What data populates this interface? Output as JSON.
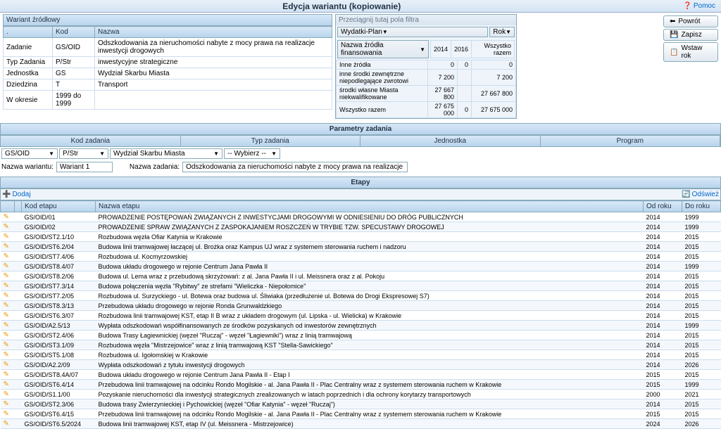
{
  "header": {
    "title": "Edycja wariantu (kopiowanie)",
    "help": "Pomoc",
    "back": "Powrót",
    "save": "Zapisz",
    "insert_year": "Wstaw rok"
  },
  "variant_panel": {
    "title": "Wariant źródłowy",
    "cols": {
      "dot": ".",
      "kod": "Kod",
      "nazwa": "Nazwa"
    },
    "rows": [
      {
        "label": "Zadanie",
        "kod": "GS/OID",
        "nazwa": "Odszkodowania za nieruchomości nabyte z mocy prawa na realizacje inwestycji drogowych"
      },
      {
        "label": "Typ Zadania",
        "kod": "P/Str",
        "nazwa": "inwestycyjne strategiczne"
      },
      {
        "label": "Jednostka",
        "kod": "GS",
        "nazwa": "Wydział Skarbu Miasta"
      },
      {
        "label": "Dziedzina",
        "kod": "T",
        "nazwa": "Transport"
      },
      {
        "label": "W okresie",
        "kod": "1999 do 1999",
        "nazwa": ""
      }
    ]
  },
  "filter": {
    "drag_hint": "Przeciągnij tutaj pola filtra",
    "wydatki": "Wydatki-Plan",
    "rok": "Rok",
    "source_label": "Nazwa źródła finansowania",
    "years": [
      "2014",
      "2016",
      "Wszystko razem"
    ],
    "rows": [
      {
        "name": "Inne źródła",
        "v": [
          "0",
          "0",
          "0"
        ]
      },
      {
        "name": "inne środki zewnętrzne niepodlegające zwrotowi",
        "v": [
          "7 200",
          "",
          "7 200"
        ]
      },
      {
        "name": "środki własne Miasta niekwalifikowane",
        "v": [
          "27 667 800",
          "",
          "27 667 800"
        ]
      },
      {
        "name": "Wszystko razem",
        "v": [
          "27 675 000",
          "0",
          "27 675 000"
        ]
      }
    ]
  },
  "params": {
    "title": "Parametry zadania",
    "headers": [
      "Kod zadania",
      "Typ zadania",
      "Jednostka",
      "Program"
    ],
    "values": [
      "GS/OID",
      "P/Str",
      "Wydział Skarbu Miasta",
      "-- Wybierz --"
    ],
    "variant_label": "Nazwa wariantu:",
    "variant_value": "Wariant 1",
    "task_label": "Nazwa zadania:",
    "task_value": "Odszkodowania za nieruchomości nabyte z mocy prawa na realizacje inwestycji drogowych"
  },
  "etapy": {
    "title": "Etapy",
    "add": "Dodaj",
    "refresh": "Odśwież",
    "cols": [
      "Kod etapu",
      "Nazwa etapu",
      "Od roku",
      "Do roku"
    ],
    "rows": [
      {
        "k": "GS/OID/01",
        "n": "PROWADZENIE POSTĘPOWAŃ ZWIĄZANYCH Z INWESTYCJAMI DROGOWYMI W ODNIESIENIU DO DRÓG PUBLICZNYCH",
        "od": "2014",
        "do": "1999"
      },
      {
        "k": "GS/OID/02",
        "n": "PROWADZENIE SPRAW ZWIĄZANYCH Z ZASPOKAJANIEM ROSZCZEŃ W TRYBIE TZW. SPECUSTAWY DROGOWEJ",
        "od": "2014",
        "do": "1999"
      },
      {
        "k": "GS/OID/ST2.1/10",
        "n": "Rozbudowa węzła Ofiar Katynia w Krakowie",
        "od": "2014",
        "do": "2015"
      },
      {
        "k": "GS/OID/ST6.2/04",
        "n": "Budowa linii tramwajowej łaczącej ul. Brożka oraz Kampus UJ wraz z systemem sterowania ruchem i nadzoru",
        "od": "2014",
        "do": "2015"
      },
      {
        "k": "GS/OID/ST7.4/06",
        "n": "Rozbudowa ul. Kocmyrzowskiej",
        "od": "2014",
        "do": "2015"
      },
      {
        "k": "GS/OID/ST8.4/07",
        "n": "Budowa układu drogowego w rejonie Centrum Jana Pawła II",
        "od": "2014",
        "do": "1999"
      },
      {
        "k": "GS/OID/ST8.2/06",
        "n": "Budowa ul. Lema wraz z przebudową skrzyżowań: z al. Jana Pawła II i ul. Meissnera oraz z al. Pokoju",
        "od": "2014",
        "do": "2015"
      },
      {
        "k": "GS/OID/ST7.3/14",
        "n": "Budowa połączenia węzła \"Rybitwy\" ze strefami \"Wieliczka - Niepołomice\"",
        "od": "2014",
        "do": "2015"
      },
      {
        "k": "GS/OID/ST7.2/05",
        "n": "Rozbudowa ul. Surzyckiego - ul. Botewa oraz budowa ul. Śliwiaka (przedłużenie ul. Botewa do Drogi Ekspresowej S7)",
        "od": "2014",
        "do": "2015"
      },
      {
        "k": "GS/OID/ST8.3/13",
        "n": "Przebudowa układu drogowego w rejonie Ronda Grunwaldzkiego",
        "od": "2014",
        "do": "2015"
      },
      {
        "k": "GS/OID/ST6.3/07",
        "n": "Rozbudowa linii tramwajowej KST, etap II B wraz z układem drogowym (ul. Lipska - ul. Wielicka) w Krakowie",
        "od": "2014",
        "do": "2015"
      },
      {
        "k": "GS/OID/A2.5/13",
        "n": "Wypłata odszkodowań współfinansowanych ze środków pozyskanych od inwestorów zewnętrznych",
        "od": "2014",
        "do": "1999"
      },
      {
        "k": "GS/OID/ST2.4/06",
        "n": "Budowa Trasy Łagiewnickiej (węzeł \"Ruczaj\" - węzeł \"Łagiewniki\") wraz z linią tramwajową",
        "od": "2014",
        "do": "2015"
      },
      {
        "k": "GS/OID/ST3.1/09",
        "n": "Rozbudowa węzła \"Mistrzejowice\" wraz z linią tramwajową KST \"Stella-Sawickiego\"",
        "od": "2014",
        "do": "2015"
      },
      {
        "k": "GS/OID/ST5.1/08",
        "n": "Rozbudowa ul. Igołomskiej w Krakowie",
        "od": "2014",
        "do": "2015"
      },
      {
        "k": "GS/OID/A2.2/09",
        "n": "Wypłata odszkodowań z tytułu inwestycji drogowych",
        "od": "2014",
        "do": "2026"
      },
      {
        "k": "GS/OID/ST8.4A/07",
        "n": "Budowa układu drogowego w rejonie Centrum Jana Pawła II - Etap I",
        "od": "2015",
        "do": "2015"
      },
      {
        "k": "GS/OID/ST6.4/14",
        "n": "Przebudowa linii tramwajowej na odcinku Rondo Mogilskie - al. Jana Pawła II - Plac Centralny wraz z systemem sterowania ruchem w Krakowie",
        "od": "2015",
        "do": "1999"
      },
      {
        "k": "GS/OID/S1.1/00",
        "n": "Pozyskanie nieruchomości dla inwestycji strategicznych zrealizowanych w latach poprzednich i dla ochrony korytarzy transportowych",
        "od": "2000",
        "do": "2021"
      },
      {
        "k": "GS/OID/ST2.3/06",
        "n": "Budowa trasy Zwierzynieckiej i Pychowickiej (węzeł \"Ofiar Katynia\" - węzeł \"Ruczaj\")",
        "od": "2014",
        "do": "2015"
      },
      {
        "k": "GS/OID/ST6.4/15",
        "n": "Przebudowa linii tramwajowej na odcinku Rondo Mogilskie - al. Jana Pawła II - Plac Centralny wraz z systemem sterowania ruchem w Krakowie",
        "od": "2015",
        "do": "2015"
      },
      {
        "k": "GS/OID/ST6.5/2024",
        "n": "Budowa linii tramwajowej KST, etap IV (ul. Meissnera - Mistrzejowice)",
        "od": "2024",
        "do": "2026"
      }
    ]
  }
}
